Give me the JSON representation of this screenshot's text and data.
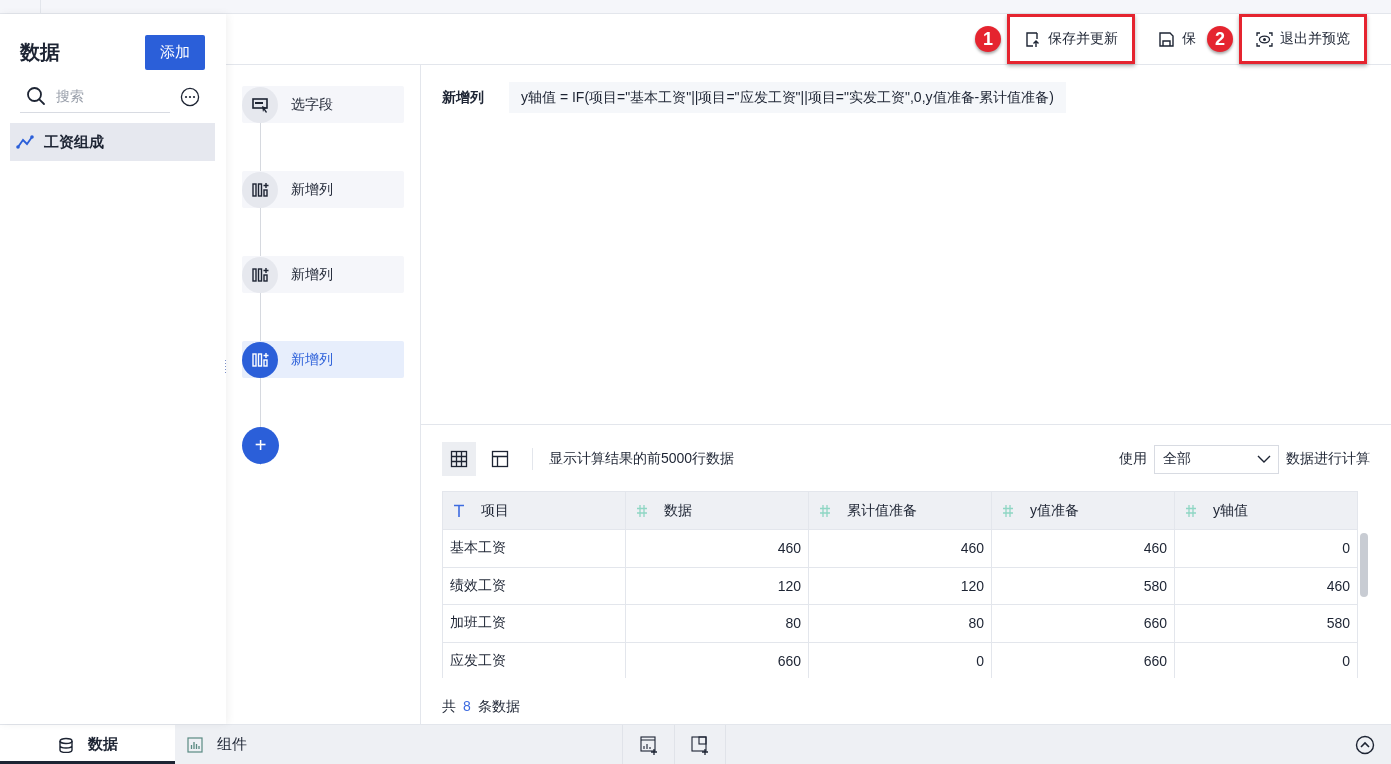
{
  "sidebar": {
    "title": "数据",
    "add_button": "添加",
    "search": {
      "placeholder": "搜索"
    },
    "items": [
      {
        "label": "工资组成",
        "selected": true
      }
    ]
  },
  "toolbar": {
    "buttons": [
      {
        "kind": "update",
        "label": "保存并更新",
        "highlighted": true,
        "badge": "1"
      },
      {
        "kind": "save",
        "label": "保",
        "highlighted": false
      },
      {
        "kind": "preview",
        "label": "退出并预览",
        "highlighted": true,
        "badge": "2"
      }
    ]
  },
  "steps": [
    {
      "kind": "select",
      "label": "选字段",
      "selected": false
    },
    {
      "kind": "column",
      "label": "新增列",
      "selected": false
    },
    {
      "kind": "column",
      "label": "新增列",
      "selected": false
    },
    {
      "kind": "column",
      "label": "新增列",
      "selected": true
    }
  ],
  "add_step": "+",
  "formula": {
    "label": "新增列",
    "expression": "y轴值 =  IF(项目=\"基本工资\"||项目=\"应发工资\"||项目=\"实发工资\",0,y值准备-累计值准备)"
  },
  "preview": {
    "views": [
      {
        "kind": "grid",
        "selected": true
      },
      {
        "kind": "layout",
        "selected": false
      }
    ],
    "caption": "显示计算结果的前5000行数据",
    "use_label": "使用",
    "scope": "全部",
    "scope_suffix": "数据进行计算",
    "table": {
      "columns": [
        {
          "kind": "text",
          "name": "项目"
        },
        {
          "kind": "number",
          "name": "数据"
        },
        {
          "kind": "number",
          "name": "累计值准备"
        },
        {
          "kind": "number",
          "name": "y值准备"
        },
        {
          "kind": "number",
          "name": "y轴值"
        }
      ],
      "rows": [
        [
          "基本工资",
          "460",
          "460",
          "460",
          "0"
        ],
        [
          "绩效工资",
          "120",
          "120",
          "580",
          "460"
        ],
        [
          "加班工资",
          "80",
          "80",
          "660",
          "580"
        ],
        [
          "应发工资",
          "660",
          "0",
          "660",
          "0"
        ]
      ]
    },
    "total": {
      "prefix": "共",
      "count": "8",
      "suffix": "条数据"
    }
  },
  "bottom_tabs": [
    {
      "kind": "data",
      "label": "数据",
      "selected": true
    },
    {
      "kind": "chart",
      "label": "组件",
      "selected": false
    }
  ]
}
